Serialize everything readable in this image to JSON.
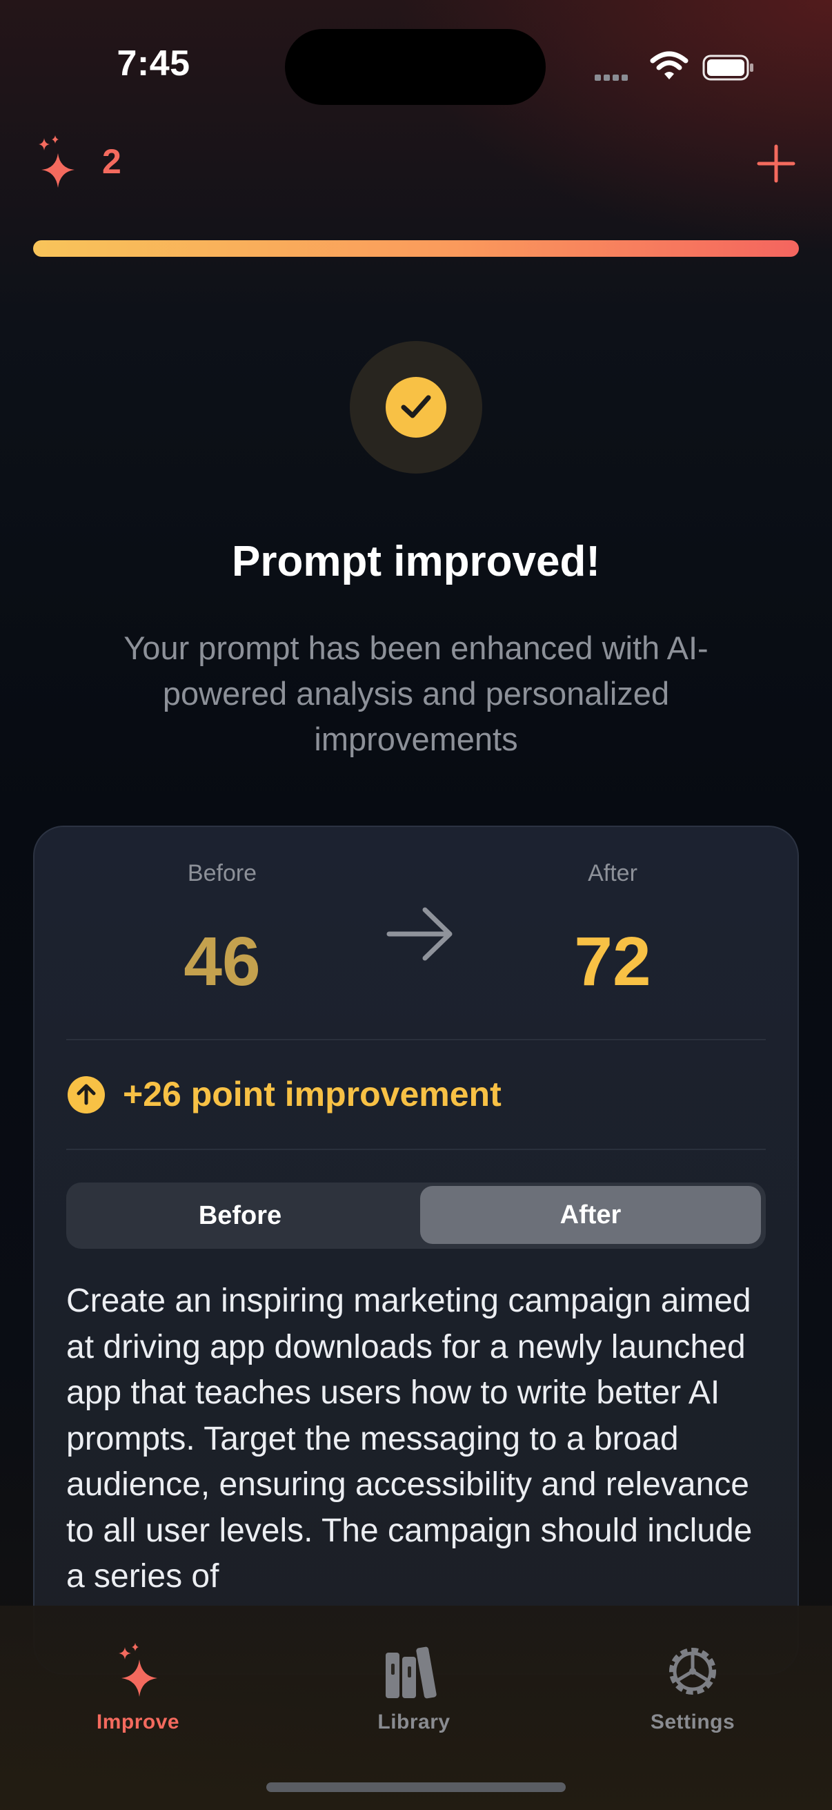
{
  "status_bar": {
    "time": "7:45"
  },
  "header": {
    "sparkle_count": "2",
    "icons": [
      "sparkle-icon",
      "plus-icon"
    ]
  },
  "progress": {
    "value": 1.0,
    "gradient": [
      "#f8c45a",
      "#f4655f"
    ]
  },
  "result": {
    "title": "Prompt improved!",
    "subtitle": "Your prompt has been enhanced with AI-powered analysis and personalized improvements"
  },
  "scores": {
    "before_label": "Before",
    "before_value": "46",
    "after_label": "After",
    "after_value": "72",
    "improvement": "+26 point improvement"
  },
  "toggle": {
    "options": [
      "Before",
      "After"
    ],
    "selected": "After"
  },
  "prompt_after": "Create an inspiring marketing campaign aimed at driving app downloads for a newly launched app that teaches users how to write better AI prompts. Target the messaging to a broad audience, ensuring accessibility and relevance to all user levels. The campaign should include a series of",
  "tabs": [
    {
      "label": "Improve",
      "icon": "sparkle-icon",
      "active": true
    },
    {
      "label": "Library",
      "icon": "books-icon",
      "active": false
    },
    {
      "label": "Settings",
      "icon": "gear-icon",
      "active": false
    }
  ],
  "colors": {
    "accent": "#f46a5e",
    "gold": "#f8c145",
    "muted": "#8d9199"
  }
}
